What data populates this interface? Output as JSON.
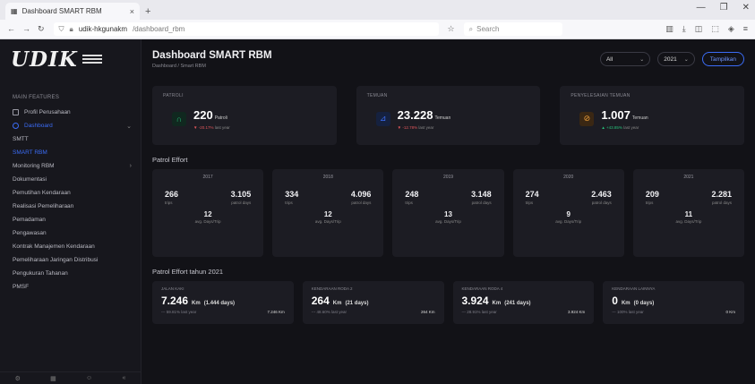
{
  "browser": {
    "tab_title": "Dashboard SMART RBM",
    "url_host": "udik-hkgunakm",
    "url_rest": "/dashboard_rbm",
    "search_placeholder": "Search"
  },
  "app": {
    "title": "Dashboard SMART RBM",
    "breadcrumb": "Dashboard  /  Smart RBM"
  },
  "filters": {
    "region": "All",
    "year": "2021",
    "show_label": "Tampilkan"
  },
  "sidebar": {
    "section_label": "MAIN FEATURES",
    "items": [
      {
        "label": "Profil Perusahaan",
        "icon": "building-icon"
      },
      {
        "label": "Dashboard",
        "icon": "dashboard-icon",
        "active": true
      }
    ],
    "sub_items": [
      "SMTT",
      "SMART RBM",
      "Monitoring RBM",
      "Dokumentasi",
      "Pemutihan Kendaraan",
      "Realisasi Pemeliharaan",
      "Pemadaman",
      "Pengawasan",
      "Kontrak Manajemen Kendaraan",
      "Pemeliharaan Jaringan Distribusi",
      "Pengukuran Tahanan",
      "PMSF"
    ]
  },
  "kpis": [
    {
      "label": "PATROLI",
      "value": "220",
      "unit": "Patroli",
      "delta": "▼ -20.17%",
      "delta_note": "last year",
      "icon": "patrol-icon",
      "color": "#27c07a"
    },
    {
      "label": "TEMUAN",
      "value": "23.228",
      "unit": "Temuan",
      "delta": "▼ -12.78%",
      "delta_note": "last year",
      "icon": "finding-icon",
      "color": "#3b6cf6"
    },
    {
      "label": "PENYELESAIAN TEMUAN",
      "value": "1.007",
      "unit": "Temuan",
      "delta": "▲ +43.85%",
      "delta_note": "last year",
      "icon": "resolve-icon",
      "color": "#f0a03a"
    }
  ],
  "patrol_effort": {
    "title": "Patrol Effort",
    "years": [
      {
        "year": "2017",
        "trips": "266",
        "trips_label": "trips",
        "patrol_days": "3.105",
        "patrol_days_label": "patrol days",
        "avg": "12",
        "avg_label": "avg. Days/Trip"
      },
      {
        "year": "2018",
        "trips": "334",
        "trips_label": "trips",
        "patrol_days": "4.096",
        "patrol_days_label": "patrol days",
        "avg": "12",
        "avg_label": "avg. Days/Trip"
      },
      {
        "year": "2019",
        "trips": "248",
        "trips_label": "trips",
        "patrol_days": "3.148",
        "patrol_days_label": "patrol days",
        "avg": "13",
        "avg_label": "avg. Days/Trip"
      },
      {
        "year": "2020",
        "trips": "274",
        "trips_label": "trips",
        "patrol_days": "2.463",
        "patrol_days_label": "patrol days",
        "avg": "9",
        "avg_label": "avg. Days/Trip"
      },
      {
        "year": "2021",
        "trips": "209",
        "trips_label": "trips",
        "patrol_days": "2.281",
        "patrol_days_label": "patrol days",
        "avg": "11",
        "avg_label": "avg. Days/Trip"
      }
    ]
  },
  "patrol_effort_2021": {
    "title": "Patrol Effort tahun 2021",
    "cards": [
      {
        "label": "JALAN KAKI",
        "num": "7.246",
        "unit": "Km",
        "days": "(1.444 days)",
        "foot_left": "--- 59.81% last year",
        "foot_right": "7.246 Km"
      },
      {
        "label": "KENDARAAN RODA 2",
        "num": "264",
        "unit": "Km",
        "days": "(21 days)",
        "foot_left": "--- 48.60% last year",
        "foot_right": "264 Km"
      },
      {
        "label": "KENDARAAN RODA 4",
        "num": "3.924",
        "unit": "Km",
        "days": "(241 days)",
        "foot_left": "--- 28.91% last year",
        "foot_right": "3.924 Km"
      },
      {
        "label": "KENDARAAN LAINNYA",
        "num": "0",
        "unit": "Km",
        "days": "(0 days)",
        "foot_left": "--- 100% last year",
        "foot_right": "0 Km"
      }
    ]
  }
}
